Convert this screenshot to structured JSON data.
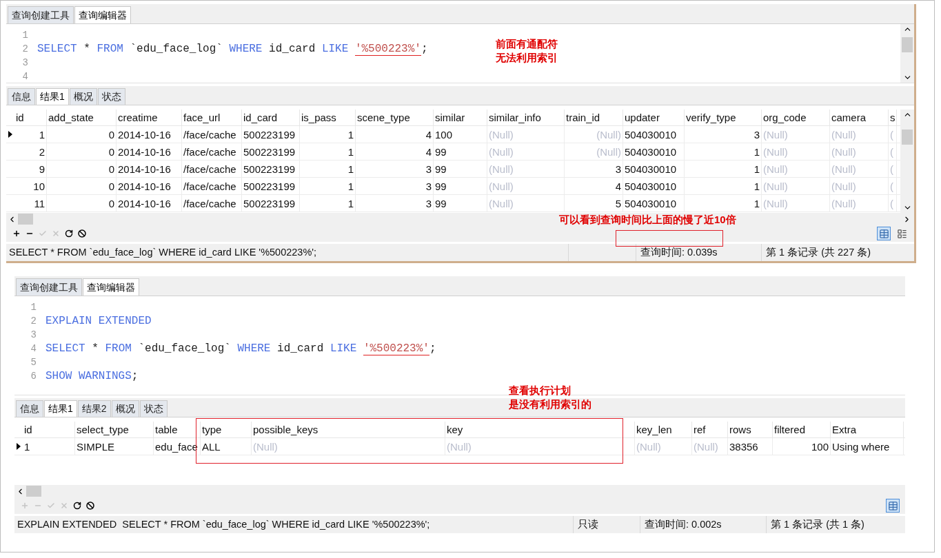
{
  "panels": [
    {
      "editor_tabs": [
        {
          "label": "查询创建工具",
          "selected": false
        },
        {
          "label": "查询编辑器",
          "selected": true
        }
      ],
      "sql_lines": [
        {
          "number": "1"
        },
        {
          "number": "2",
          "tokens": [
            {
              "text": "SELECT",
              "kind": "keyword"
            },
            {
              "text": " * ",
              "kind": "plain"
            },
            {
              "text": "FROM",
              "kind": "keyword"
            },
            {
              "text": " `edu_face_log` ",
              "kind": "plain"
            },
            {
              "text": "WHERE",
              "kind": "keyword"
            },
            {
              "text": " id_card ",
              "kind": "plain"
            },
            {
              "text": "LIKE ",
              "kind": "keyword"
            },
            {
              "text": "'%500223%'",
              "kind": "string",
              "underlined": true
            },
            {
              "text": ";",
              "kind": "plain"
            }
          ]
        },
        {
          "number": "3"
        },
        {
          "number": "4"
        }
      ],
      "result_tabs": [
        {
          "label": "信息",
          "selected": false
        },
        {
          "label": "结果1",
          "selected": true
        },
        {
          "label": "概况",
          "selected": false
        },
        {
          "label": "状态",
          "selected": false
        }
      ],
      "columns": [
        {
          "name": "id",
          "numeric": true
        },
        {
          "name": "add_state",
          "numeric": true
        },
        {
          "name": "creatime",
          "numeric": false
        },
        {
          "name": "face_url",
          "numeric": false
        },
        {
          "name": "id_card",
          "numeric": false
        },
        {
          "name": "is_pass",
          "numeric": true
        },
        {
          "name": "scene_type",
          "numeric": true
        },
        {
          "name": "similar",
          "numeric": false
        },
        {
          "name": "similar_info",
          "numeric": false
        },
        {
          "name": "train_id",
          "numeric": true
        },
        {
          "name": "updater",
          "numeric": false
        },
        {
          "name": "verify_type",
          "numeric": true
        },
        {
          "name": "org_code",
          "numeric": false
        },
        {
          "name": "camera",
          "numeric": false
        },
        {
          "name": "s",
          "numeric": false
        }
      ],
      "rows": [
        {
          "selected": true,
          "cells": [
            "1",
            "0",
            "2014-10-16",
            "/face/cache",
            "500223199",
            "1",
            "4",
            "100",
            {
              "null": "(Null)"
            },
            {
              "null": "(Null)"
            },
            "504030010",
            "3",
            {
              "null": "(Null)"
            },
            {
              "null": "(Null)"
            },
            {
              "null": "("
            }
          ]
        },
        {
          "selected": false,
          "cells": [
            "2",
            "0",
            "2014-10-16",
            "/face/cache",
            "500223199",
            "1",
            "4",
            "99",
            {
              "null": "(Null)"
            },
            {
              "null": "(Null)"
            },
            "504030010",
            "1",
            {
              "null": "(Null)"
            },
            {
              "null": "(Null)"
            },
            {
              "null": "("
            }
          ]
        },
        {
          "selected": false,
          "cells": [
            "9",
            "0",
            "2014-10-16",
            "/face/cache",
            "500223199",
            "1",
            "3",
            "99",
            {
              "null": "(Null)"
            },
            "3",
            "504030010",
            "1",
            {
              "null": "(Null)"
            },
            {
              "null": "(Null)"
            },
            {
              "null": "("
            }
          ]
        },
        {
          "selected": false,
          "cells": [
            "10",
            "0",
            "2014-10-16",
            "/face/cache",
            "500223199",
            "1",
            "3",
            "99",
            {
              "null": "(Null)"
            },
            "4",
            "504030010",
            "1",
            {
              "null": "(Null)"
            },
            {
              "null": "(Null)"
            },
            {
              "null": "("
            }
          ]
        },
        {
          "selected": false,
          "cells": [
            "11",
            "0",
            "2014-10-16",
            "/face/cache",
            "500223199",
            "1",
            "3",
            "99",
            {
              "null": "(Null)"
            },
            "5",
            "504030010",
            "1",
            {
              "null": "(Null)"
            },
            {
              "null": "(Null)"
            },
            {
              "null": "("
            }
          ]
        }
      ],
      "toolbar": [
        {
          "kind": "add",
          "disabled": false
        },
        {
          "kind": "remove",
          "disabled": false
        },
        {
          "kind": "apply",
          "disabled": true
        },
        {
          "kind": "cancel",
          "disabled": true
        },
        {
          "kind": "refresh",
          "disabled": false
        },
        {
          "kind": "stop",
          "disabled": false
        }
      ],
      "view_buttons": [
        {
          "kind": "grid",
          "selected": true
        },
        {
          "kind": "form",
          "selected": false
        }
      ],
      "status": {
        "sql": "SELECT * FROM `edu_face_log` WHERE id_card LIKE '%500223%';",
        "time": "查询时间: 0.039s",
        "records": "第 1 条记录 (共 227 条)"
      }
    },
    {
      "editor_tabs": [
        {
          "label": "查询创建工具",
          "selected": false
        },
        {
          "label": "查询编辑器",
          "selected": true
        }
      ],
      "sql_lines": [
        {
          "number": "1"
        },
        {
          "number": "2",
          "tokens": [
            {
              "text": "EXPLAIN EXTENDED",
              "kind": "keyword"
            }
          ]
        },
        {
          "number": "3"
        },
        {
          "number": "4",
          "tokens": [
            {
              "text": "SELECT",
              "kind": "keyword"
            },
            {
              "text": " * ",
              "kind": "plain"
            },
            {
              "text": "FROM",
              "kind": "keyword"
            },
            {
              "text": " `edu_face_log` ",
              "kind": "plain"
            },
            {
              "text": "WHERE",
              "kind": "keyword"
            },
            {
              "text": " id_card ",
              "kind": "plain"
            },
            {
              "text": "LIKE ",
              "kind": "keyword"
            },
            {
              "text": "'%500223%'",
              "kind": "string",
              "underlined": true
            },
            {
              "text": ";",
              "kind": "plain"
            }
          ]
        },
        {
          "number": "5"
        },
        {
          "number": "6",
          "tokens": [
            {
              "text": "SHOW WARNINGS",
              "kind": "keyword"
            },
            {
              "text": ";",
              "kind": "plain"
            }
          ]
        }
      ],
      "result_tabs": [
        {
          "label": "信息",
          "selected": false
        },
        {
          "label": "结果1",
          "selected": true
        },
        {
          "label": "结果2",
          "selected": false
        },
        {
          "label": "概况",
          "selected": false
        },
        {
          "label": "状态",
          "selected": false
        }
      ],
      "columns": [
        {
          "name": "id",
          "numeric": false
        },
        {
          "name": "select_type",
          "numeric": false
        },
        {
          "name": "table",
          "numeric": false
        },
        {
          "name": "type",
          "numeric": false
        },
        {
          "name": "possible_keys",
          "numeric": false
        },
        {
          "name": "key",
          "numeric": false
        },
        {
          "name": "key_len",
          "numeric": false
        },
        {
          "name": "ref",
          "numeric": false
        },
        {
          "name": "rows",
          "numeric": false
        },
        {
          "name": "filtered",
          "numeric": true
        },
        {
          "name": "Extra",
          "numeric": false
        }
      ],
      "rows": [
        {
          "selected": true,
          "cells": [
            "1",
            "SIMPLE",
            "edu_face",
            "ALL",
            {
              "null": "(Null)"
            },
            {
              "null": "(Null)"
            },
            {
              "null": "(Null)"
            },
            {
              "null": "(Null)"
            },
            "38356",
            "100",
            "Using where"
          ]
        }
      ],
      "toolbar": [
        {
          "kind": "add",
          "disabled": true
        },
        {
          "kind": "remove",
          "disabled": true
        },
        {
          "kind": "apply",
          "disabled": true
        },
        {
          "kind": "cancel",
          "disabled": true
        },
        {
          "kind": "refresh",
          "disabled": false
        },
        {
          "kind": "stop",
          "disabled": false
        }
      ],
      "view_buttons": [
        {
          "kind": "grid",
          "selected": true
        }
      ],
      "status": {
        "sql": "EXPLAIN EXTENDED  SELECT * FROM `edu_face_log` WHERE id_card LIKE '%500223%';",
        "mode": "只读",
        "time": "查询时间: 0.002s",
        "records": "第 1 条记录 (共 1 条)"
      }
    }
  ],
  "annotations": [
    {
      "kind": "note",
      "lines": [
        "前面有通配符",
        "无法利用索引"
      ]
    },
    {
      "kind": "note",
      "lines": [
        "可以看到查询时间比上面的慢了近10倍"
      ]
    },
    {
      "kind": "box"
    },
    {
      "kind": "note",
      "lines": [
        "查看执行计划",
        "是没有利用索引的"
      ]
    },
    {
      "kind": "box"
    }
  ]
}
